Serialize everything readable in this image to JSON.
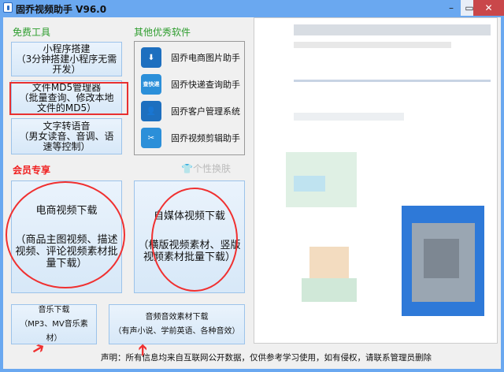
{
  "window": {
    "title": "固乔视频助手 V96.0",
    "minimize": "–",
    "maximize": "▭",
    "close": "✕"
  },
  "free_tools": {
    "heading": "免费工具",
    "buttons": [
      {
        "lines": [
          "小程序搭建",
          "（3分钟搭建小程序无需开发）"
        ]
      },
      {
        "lines": [
          "文件MD5管理器",
          "（批量查询、修改本地文件的MD5）"
        ]
      },
      {
        "lines": [
          "文字转语音",
          "（男女读音、音调、语速等控制）"
        ]
      }
    ]
  },
  "other_software": {
    "heading": "其他优秀软件",
    "items": [
      {
        "label": "固乔电商图片助手",
        "icon": "download-icon",
        "glyph": "⬇"
      },
      {
        "label": "固乔快递查询助手",
        "icon": "express-search-icon",
        "glyph": "查快递"
      },
      {
        "label": "固乔客户管理系统",
        "icon": "customer-icon",
        "glyph": "👤"
      },
      {
        "label": "固乔视频剪辑助手",
        "icon": "scissors-icon",
        "glyph": "✂"
      }
    ]
  },
  "member": {
    "heading": "会员专享",
    "skin_label": "个性换肤",
    "skin_icon": "👕",
    "big_buttons": [
      {
        "title": "电商视频下载",
        "desc": "（商品主图视频、描述视频、评论视频素材批量下载）"
      },
      {
        "title": "自媒体视频下载",
        "desc": "（横版视频素材、竖版视频素材批量下载）"
      }
    ],
    "small_buttons": [
      {
        "title": "音乐下载",
        "desc": "（MP3、MV音乐素材）"
      },
      {
        "title": "音频音效素材下载",
        "desc": "（有声小说、学前英语、各种音效）"
      }
    ]
  },
  "declaration": "声明：所有信息均来自互联网公开数据，仅供参考学习使用，如有侵权，请联系管理员删除"
}
